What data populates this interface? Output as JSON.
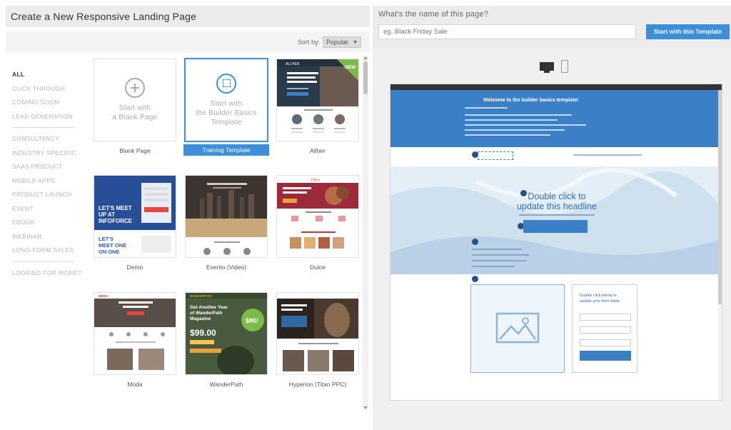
{
  "left": {
    "title": "Create a New Responsive Landing Page",
    "sort_label": "Sort by:",
    "sort_value": "Popular",
    "categories": [
      "ALL",
      "CLICK THROUGH",
      "COMING SOON",
      "LEAD GENERATION",
      "CONSULTANCY",
      "INDUSTRY SPECIFIC",
      "SAAS PRODUCT",
      "MOBILE APPS",
      "PRODUCT LAUNCH",
      "EVENT",
      "EBOOK",
      "WEBINAR",
      "LONG-FORM SALES",
      "LOOKING FOR MORE?"
    ],
    "active_category": "ALL",
    "blank_card_text": [
      "Start with",
      "a Blank Page"
    ],
    "builder_card_text": [
      "Start with",
      "the Builder Basics",
      "Template"
    ],
    "templates": [
      {
        "name": "Blank Page"
      },
      {
        "name": "Training Template",
        "selected": true
      },
      {
        "name": "Allher",
        "badge": "NEW"
      },
      {
        "name": "Demo"
      },
      {
        "name": "Evento (Video)"
      },
      {
        "name": "Dulce"
      },
      {
        "name": "Moda"
      },
      {
        "name": "WanderPath"
      },
      {
        "name": "Hyperion (Titan PPC)"
      }
    ]
  },
  "thumb_text": {
    "allher": "AN ATTENTION GRABBING HEADLINE WITH ONE STRONG IDEA",
    "allher_logo": "ALLHER",
    "demo_1": "LET'S MEET UP AT INFOFORCE",
    "demo_2": "LET'S MEET ONE ON ONE",
    "dulce": "Dulce",
    "wander_1": "Get Another Year of WanderPath Magazine",
    "wander_2": "$99.00",
    "wander_3": "$80!",
    "wander_logo": "WANDERPATH",
    "moda": "MODA",
    "moda_head": "Look Perfect for Work + Play"
  },
  "right": {
    "question": "What's the name of this page?",
    "input_placeholder": "eg. Black Friday Sale",
    "button_label": "Start with this Template",
    "preview": {
      "hero_title": "Welcome to the builder basics template!",
      "headline_1": "Double click to",
      "headline_2": "update this headline",
      "form_title_1": "Double click below to",
      "form_title_2": "update your form fields."
    }
  },
  "colors": {
    "accent": "#3d8fd8",
    "header_bg": "#ececec",
    "hero_bg": "#3b80c6"
  }
}
